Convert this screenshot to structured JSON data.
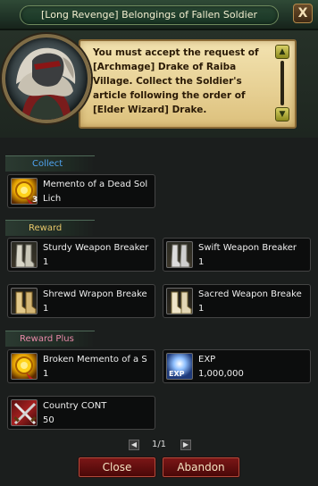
{
  "window": {
    "title": "[Long Revenge] Belongings of Fallen Soldier",
    "close_label": "X"
  },
  "quest": {
    "description": "You must accept the request of [Archmage] Drake of Raiba Village. Collect the Soldier's article following the order of [Elder Wizard] Drake.",
    "scroll_up": "▲",
    "scroll_down": "▼"
  },
  "sections": {
    "collect": "Collect",
    "reward": "Reward",
    "reward_plus": "Reward Plus"
  },
  "collect_items": [
    {
      "name": "Memento of a Dead Sol",
      "qty": "Lich",
      "badge": "3",
      "icon": "gold-coin-icon"
    }
  ],
  "reward_items": [
    {
      "name": "Sturdy Weapon Breaker",
      "qty": "1",
      "icon": "boots-icon"
    },
    {
      "name": "Swift Weapon Breaker",
      "qty": "1",
      "icon": "boots-icon"
    },
    {
      "name": "Shrewd Wrapon Breake",
      "qty": "1",
      "icon": "boots-icon"
    },
    {
      "name": "Sacred Weapon Breake",
      "qty": "1",
      "icon": "boots-icon"
    }
  ],
  "reward_plus_items": [
    {
      "name": "Broken Memento of a S",
      "qty": "1",
      "icon": "gold-coin-icon"
    },
    {
      "name": "EXP",
      "qty": "1,000,000",
      "icon": "exp-icon",
      "icon_label": "EXP"
    },
    {
      "name": "Country CONT",
      "qty": "50",
      "icon": "crossed-swords-icon"
    }
  ],
  "pager": {
    "text": "1/1",
    "prev": "◀",
    "next": "▶"
  },
  "buttons": {
    "close": "Close",
    "abandon": "Abandon"
  }
}
